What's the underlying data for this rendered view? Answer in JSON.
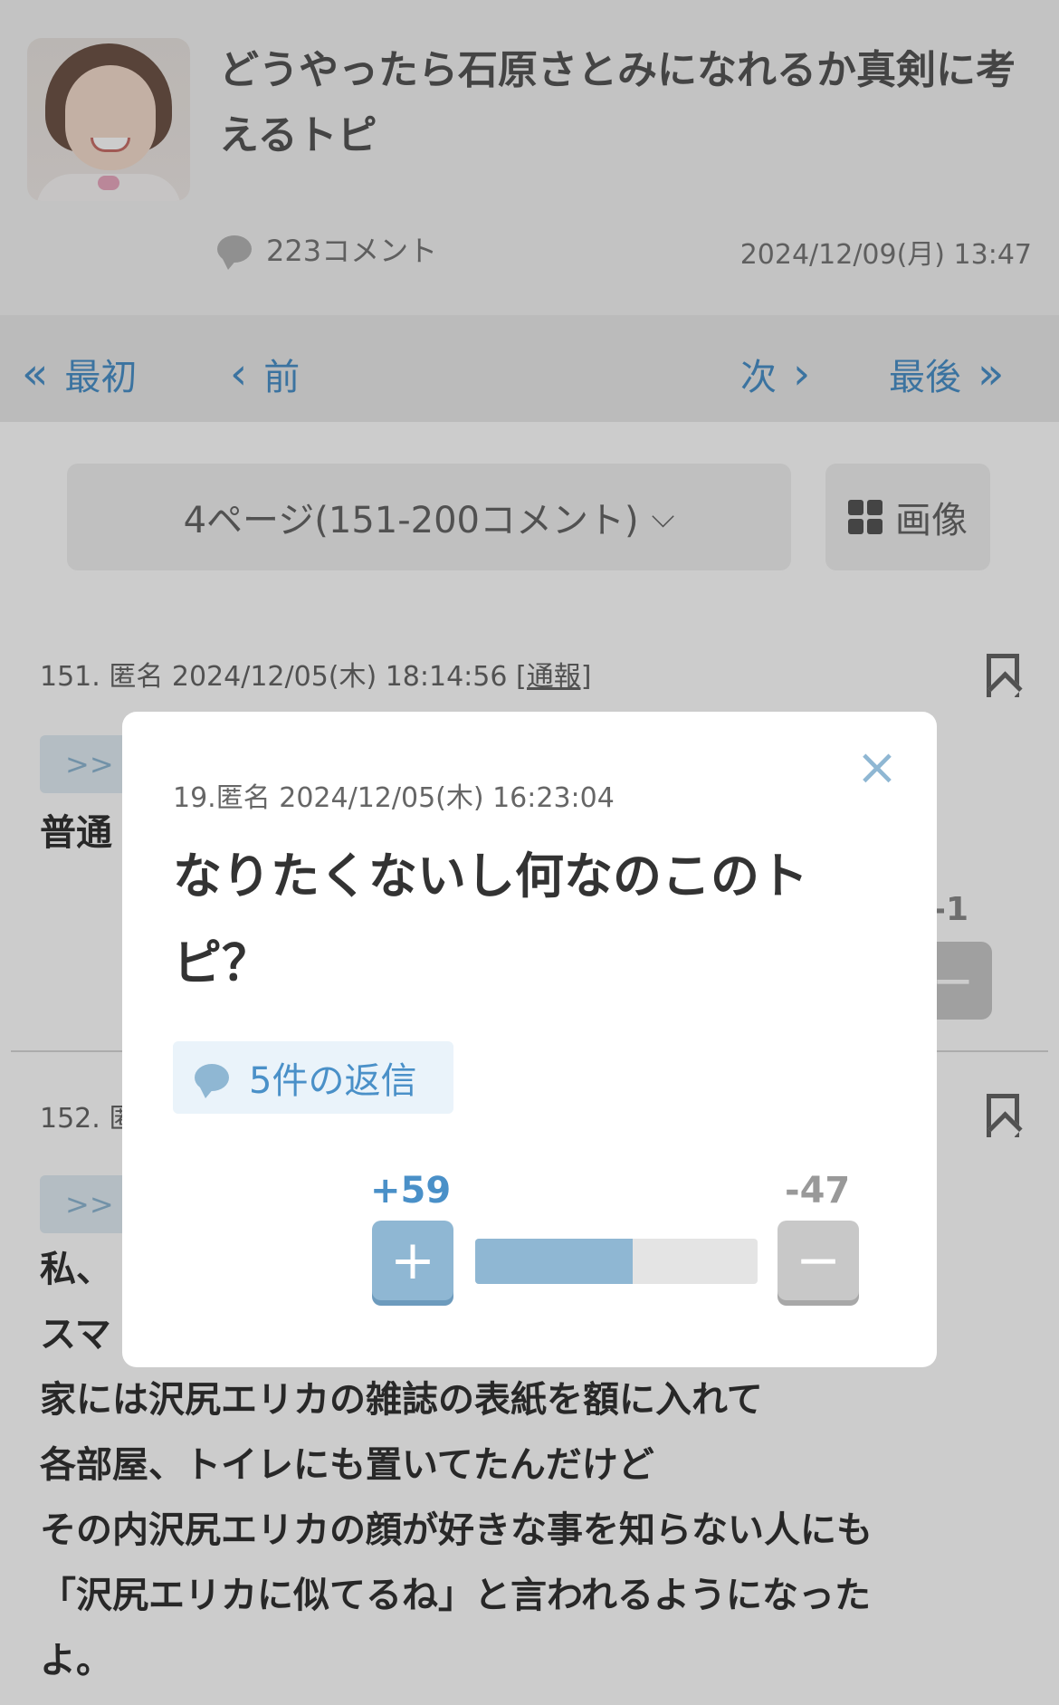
{
  "topic": {
    "title": "どうやったら石原さとみになれるか真剣に考えるトピ",
    "comment_count": "223コメント",
    "date": "2024/12/09(月) 13:47"
  },
  "pager": {
    "first": "最初",
    "prev": "前",
    "next": "次",
    "last": "最後"
  },
  "page_select": {
    "label": "4ページ(151-200コメント)",
    "image_button": "画像"
  },
  "comments": [
    {
      "meta": "151. 匿名 2024/12/05(木) 18:14:56",
      "report": "[通報]",
      "anchor": ">>",
      "body": "普通",
      "minus_value": "-1"
    },
    {
      "meta": "152. 匿",
      "anchor": ">>",
      "body_lines": [
        "私、",
        "スマ",
        "家には沢尻エリカの雑誌の表紙を額に入れて",
        "各部屋、トイレにも置いてたんだけど",
        "その内沢尻エリカの顔が好きな事を知らない人にも",
        "「沢尻エリカに似てるね」と言われるようになった",
        "よ。"
      ]
    }
  ],
  "modal": {
    "meta": "19.匿名 2024/12/05(木) 16:23:04",
    "body": "なりたくないし何なのこのトピ？",
    "reply_label": "5件の返信",
    "plus": "+59",
    "minus": "-47",
    "plus_ratio": 0.557
  },
  "colors": {
    "accent": "#4a90c8",
    "accent_light": "#8fb7d3",
    "overlay": "rgba(0,0,0,0.2)"
  },
  "icons": {
    "close": "close-icon",
    "comment": "speech-bubble-icon",
    "bookmark": "bookmark-icon",
    "grid": "grid-icon"
  }
}
